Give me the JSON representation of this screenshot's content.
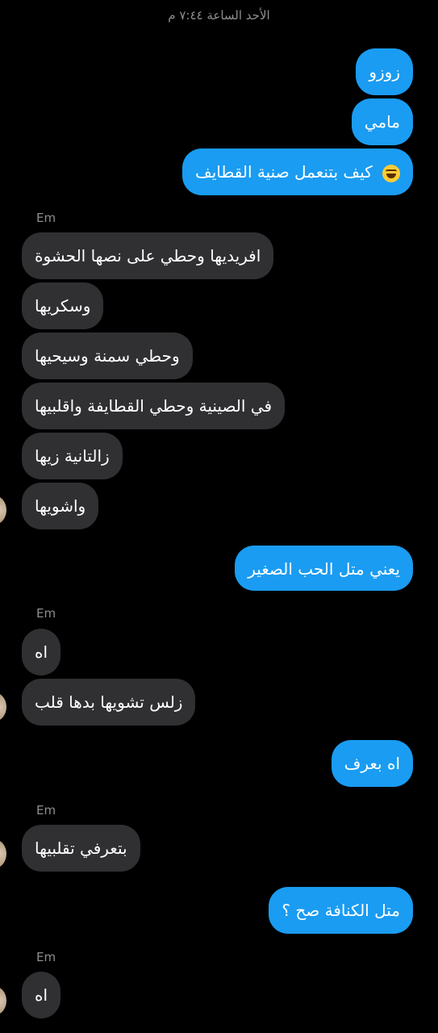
{
  "header": {
    "timestamp": "الأحد الساعة ٧:٤٤ م"
  },
  "messages": [
    {
      "from": "me",
      "text": "زوزو"
    },
    {
      "from": "me",
      "text": "مامي"
    },
    {
      "from": "me",
      "text": "كيف بتنعمل صنية القطايف",
      "emoji": "laughing-face-icon"
    },
    {
      "from": "Em",
      "text": "افريديها وحطي على نصها الحشوة"
    },
    {
      "from": "Em",
      "text": "وسكريها"
    },
    {
      "from": "Em",
      "text": "وحطي سمنة وسيحيها"
    },
    {
      "from": "Em",
      "text": "في الصينية وحطي القطايفة واقلبيها"
    },
    {
      "from": "Em",
      "text": "زالتانية زيها"
    },
    {
      "from": "Em",
      "text": "واشويها"
    },
    {
      "from": "me",
      "text": "يعني متل الحب الصغير"
    },
    {
      "from": "Em",
      "text": "اه"
    },
    {
      "from": "Em",
      "text": "زلس تشويها بدها قلب"
    },
    {
      "from": "me",
      "text": "اه بعرف"
    },
    {
      "from": "Em",
      "text": "بتعرفي تقلبيها"
    },
    {
      "from": "me",
      "text": "متل الكنافة صح ؟"
    },
    {
      "from": "Em",
      "text": "اه"
    }
  ],
  "sender_labels": [
    "Em",
    "Em",
    "Em",
    "Em"
  ],
  "colors": {
    "outgoing": "#1a9cf2",
    "incoming": "#303033",
    "background": "#000000",
    "meta_text": "#8e8e93"
  }
}
